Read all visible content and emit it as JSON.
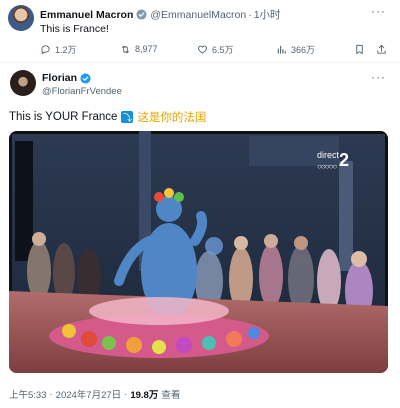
{
  "tweet1": {
    "name": "Emmanuel Macron",
    "handle": "@EmmanuelMacron",
    "separator": "·",
    "time": "1小时",
    "more": "···",
    "text": "This is France!",
    "replies": "1.2万",
    "retweets": "8,977",
    "likes": "6.5万",
    "views": "366万"
  },
  "tweet2": {
    "name": "Florian",
    "handle": "@FlorianFrVendee",
    "more": "···",
    "text_en": "This is YOUR France",
    "arrow_emoji": "⤵",
    "text_cn": "这是你的法国",
    "media": {
      "channel_small": "direct",
      "channel_number": "2",
      "rings": "○○○○○"
    },
    "footer": {
      "time": "上午5:33",
      "dot": "·",
      "date": "2024年7月27日",
      "views": "19.8万",
      "views_label": "查看"
    }
  },
  "colors": {
    "verified_gray": "#829aab",
    "verified_blue": "#1d9bf0",
    "secondary_text": "#536471",
    "highlight_yellow": "#e8a400"
  },
  "icons": [
    "reply-icon",
    "retweet-icon",
    "like-icon",
    "views-icon",
    "bookmark-icon",
    "share-icon",
    "verified-badge-icon",
    "arrow-down-right-icon"
  ]
}
